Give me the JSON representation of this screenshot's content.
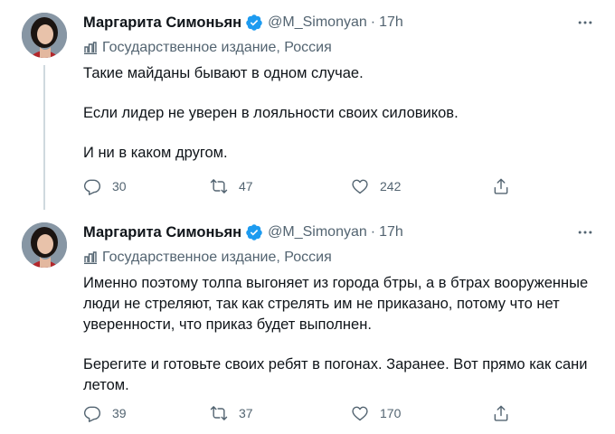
{
  "tweets": [
    {
      "author": {
        "name": "Маргарита Симоньян",
        "handle": "@M_Simonyan"
      },
      "separator": "·",
      "time": "17h",
      "label": "Государственное издание, Россия",
      "paragraphs": [
        "Такие майданы бывают в одном случае.",
        "Если лидер не уверен в лояльности своих силовиков.",
        "И ни в каком другом."
      ],
      "stats": {
        "replies": "30",
        "retweets": "47",
        "likes": "242"
      },
      "icons": {
        "more": "more-icon",
        "label": "government-label-icon",
        "verified": "verified-badge-icon"
      }
    },
    {
      "author": {
        "name": "Маргарита Симоньян",
        "handle": "@M_Simonyan"
      },
      "separator": "·",
      "time": "17h",
      "label": "Государственное издание, Россия",
      "paragraphs": [
        "Именно поэтому толпа выгоняет из города бтры, а в бтрах вооруженные люди не стреляют, так как стрелять им не приказано, потому что нет уверенности, что приказ будет выполнен.",
        "Берегите и готовьте своих ребят в погонах. Заранее. Вот прямо как сани летом."
      ],
      "stats": {
        "replies": "39",
        "retweets": "37",
        "likes": "170"
      },
      "icons": {
        "more": "more-icon",
        "label": "government-label-icon",
        "verified": "verified-badge-icon"
      }
    }
  ],
  "colors": {
    "text": "#0f1419",
    "secondary": "#536471",
    "verified": "#1d9bf0",
    "thread_line": "#cfd9de"
  }
}
